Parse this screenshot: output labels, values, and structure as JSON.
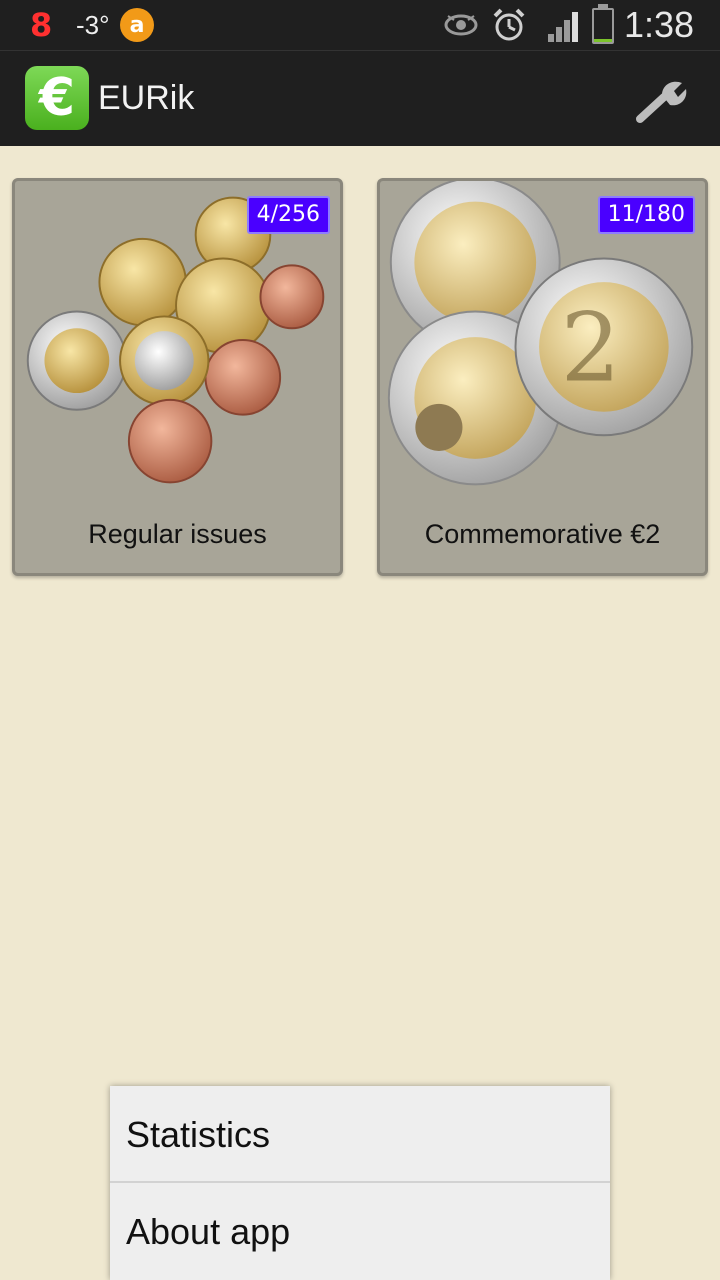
{
  "status_bar": {
    "badge_number": "8",
    "temperature": "-3°",
    "app_icon_letter": "a",
    "time": "1:38",
    "icons": [
      "eye-icon",
      "alarm-icon",
      "signal-icon",
      "battery-icon"
    ]
  },
  "action_bar": {
    "logo_symbol": "€",
    "title": "EURik",
    "settings_icon": "wrench-icon"
  },
  "cards": [
    {
      "label": "Regular issues",
      "count": "4/256"
    },
    {
      "label": "Commemorative €2",
      "count": "11/180"
    }
  ],
  "menu": {
    "items": [
      "Statistics",
      "About app"
    ]
  },
  "colors": {
    "badge": "#4a00ff",
    "logo": "#5cc426",
    "background": "#efe8d0"
  }
}
